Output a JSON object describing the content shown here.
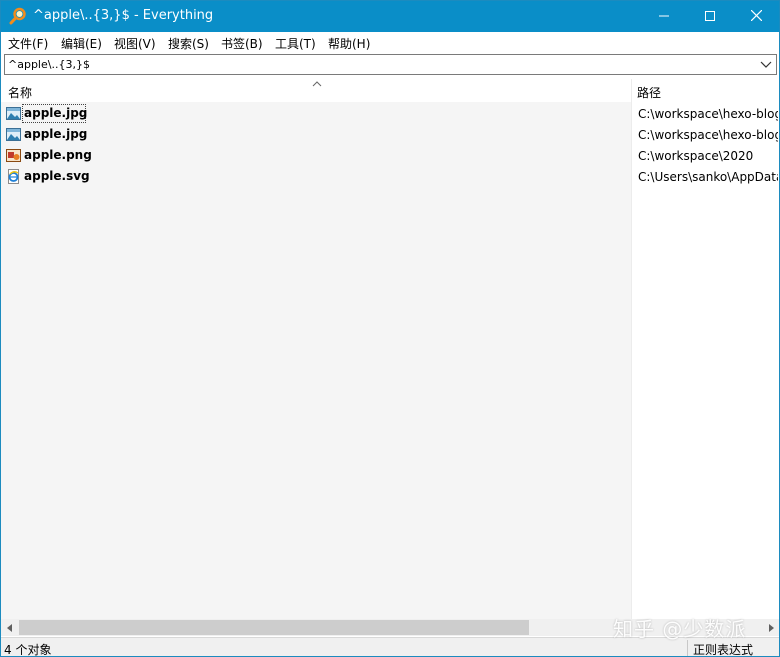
{
  "window": {
    "title": "^apple\\..{3,}$ - Everything",
    "accent_color": "#0a8ec8",
    "icons": {
      "app": "magnifier-icon",
      "minimize": "minimize-icon",
      "maximize": "maximize-icon",
      "close": "close-icon"
    }
  },
  "menubar": {
    "items": [
      "文件(F)",
      "编辑(E)",
      "视图(V)",
      "搜索(S)",
      "书签(B)",
      "工具(T)",
      "帮助(H)"
    ]
  },
  "search": {
    "value": "^apple\\..{3,}$",
    "dropdown_icon": "chevron-down-icon"
  },
  "columns": {
    "name": "名称",
    "path": "路径",
    "sort_icon": "sort-up-icon"
  },
  "results": [
    {
      "name": "apple.jpg",
      "path": "C:\\workspace\\hexo-blog",
      "icon": "image-file-icon"
    },
    {
      "name": "apple.jpg",
      "path": "C:\\workspace\\hexo-blog",
      "icon": "image-file-icon"
    },
    {
      "name": "apple.png",
      "path": "C:\\workspace\\2020",
      "icon": "png-file-icon"
    },
    {
      "name": "apple.svg",
      "path": "C:\\Users\\sanko\\AppData",
      "icon": "svg-file-icon"
    }
  ],
  "statusbar": {
    "count": "4 个对象",
    "mode": "正则表达式"
  },
  "watermark": "知乎 @少数派"
}
